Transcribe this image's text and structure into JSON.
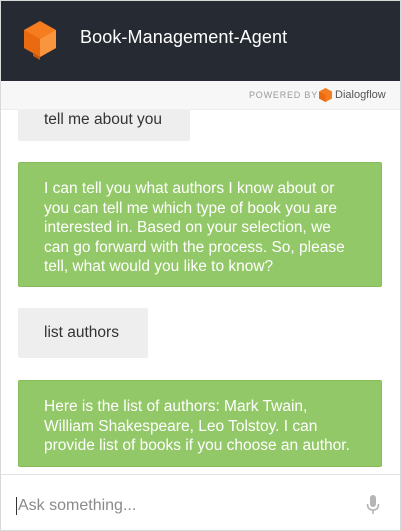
{
  "header": {
    "title": "Book-Management-Agent"
  },
  "powered": {
    "label": "POWERED BY",
    "brand": "Dialogflow"
  },
  "messages": [
    {
      "from": "user",
      "text": "tell me about you"
    },
    {
      "from": "agent",
      "text": "I can tell you what authors I know about or you can tell me which type of book you are interested in. Based on your selection, we can go forward with the process. So, please tell, what would you like to know?"
    },
    {
      "from": "user",
      "text": "list authors"
    },
    {
      "from": "agent",
      "text": "Here is the list of authors: Mark Twain, William Shakespeare, Leo Tolstoy. I can provide list of books if you choose an author."
    }
  ],
  "input": {
    "placeholder": "Ask something...",
    "value": ""
  },
  "icons": {
    "logo": "dialogflow-logo-icon",
    "mic": "microphone-icon"
  },
  "colors": {
    "header_bg": "#262a33",
    "agent_bubble": "#93c868",
    "user_bubble": "#eeeeee",
    "brand_orange": "#f57c1f"
  }
}
